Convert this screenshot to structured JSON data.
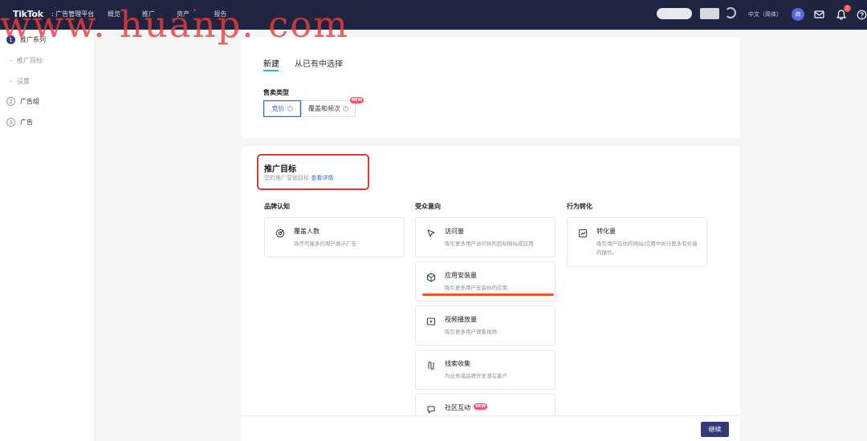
{
  "header": {
    "brand": "TikTok",
    "brand_sub": ": 广告管理平台",
    "nav": [
      "概览",
      "推广",
      "资产",
      "报告"
    ],
    "nav_dot": "*",
    "lang": "中文（简体）",
    "avatar_initial": "商",
    "notification_count": "2",
    "icons": {
      "mail": "mail-icon",
      "bell": "bell-icon",
      "help": "help-icon"
    }
  },
  "watermark": "www. huanp. com",
  "sidebar": {
    "steps": [
      {
        "num": "1",
        "label": "推广系列"
      },
      {
        "num": "2",
        "label": "广告组"
      },
      {
        "num": "3",
        "label": "广告"
      }
    ],
    "substeps": [
      "推广目标",
      "设置"
    ]
  },
  "card1": {
    "tabs": [
      "新建",
      "从已有中选择"
    ],
    "buy_type_label": "售卖类型",
    "buy_options": [
      "竞价",
      "覆盖和频次"
    ],
    "new_badge": "NEW"
  },
  "objective": {
    "title": "推广目标",
    "desc": "您的推广营销目标",
    "desc_link": "查看详情",
    "columns": [
      {
        "heading": "品牌认知",
        "items": [
          {
            "title": "覆盖人数",
            "desc": "尚尽可能多的用户展示广告",
            "icon": "target-icon"
          }
        ]
      },
      {
        "heading": "受众意向",
        "items": [
          {
            "title": "访问量",
            "desc": "吸引更多用户访问你的目标网站或应用",
            "icon": "cursor-icon"
          },
          {
            "title": "应用安装量",
            "desc": "吸引更多用户安装你的应用",
            "icon": "cube-icon"
          },
          {
            "title": "视频播放量",
            "desc": "吸引更多用户观看视频",
            "icon": "video-icon"
          },
          {
            "title": "线索收集",
            "desc": "为业务或品牌开发潜在客户",
            "icon": "leads-icon"
          },
          {
            "title": "社区互动",
            "desc": "",
            "icon": "community-icon"
          }
        ]
      },
      {
        "heading": "行为转化",
        "items": [
          {
            "title": "转化量",
            "desc": "吸引用户在你的网站/应用中执行更多有价值的操作。",
            "icon": "chart-icon"
          }
        ]
      }
    ]
  },
  "footer": {
    "continue_label": "继续"
  },
  "colors": {
    "accent": "#333a7a",
    "highlight": "#e23b2e",
    "link": "#3b68c9",
    "topbar": "#1f2540"
  }
}
